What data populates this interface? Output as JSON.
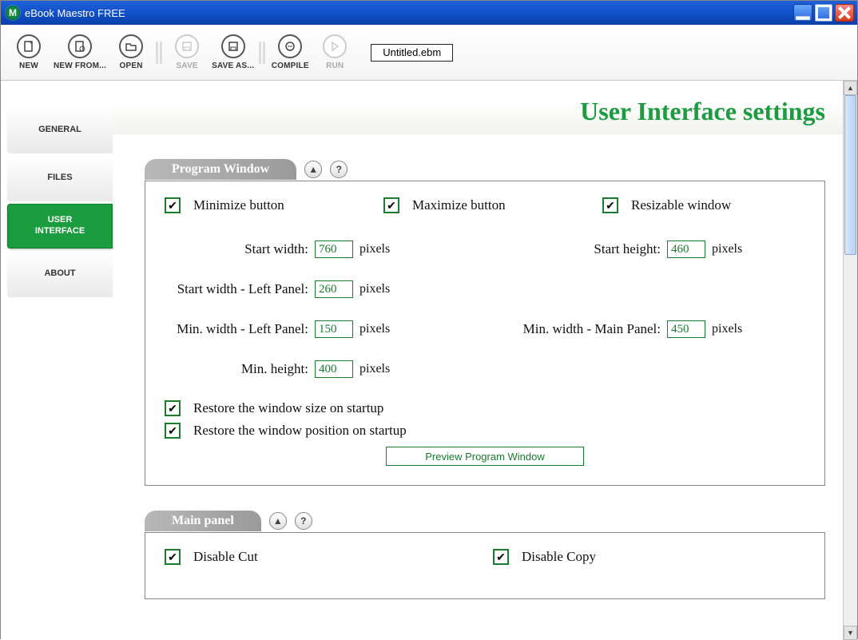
{
  "window": {
    "title": "eBook Maestro FREE",
    "file": "Untitled.ebm"
  },
  "toolbar": {
    "new": "NEW",
    "new_from": "NEW FROM...",
    "open": "OPEN",
    "save": "SAVE",
    "save_as": "SAVE AS...",
    "compile": "COMPILE",
    "run": "RUN"
  },
  "sidebar": {
    "general": "GENERAL",
    "files": "FILES",
    "ui": "USER\nINTERFACE",
    "about": "ABOUT"
  },
  "page": {
    "title": "User Interface settings"
  },
  "program_window": {
    "heading": "Program Window",
    "minimize_label": "Minimize button",
    "maximize_label": "Maximize button",
    "resizable_label": "Resizable window",
    "start_width_label": "Start width:",
    "start_width_value": "760",
    "start_height_label": "Start height:",
    "start_height_value": "460",
    "start_width_left_label": "Start width - Left Panel:",
    "start_width_left_value": "260",
    "min_width_left_label": "Min. width - Left Panel:",
    "min_width_left_value": "150",
    "min_width_main_label": "Min. width - Main Panel:",
    "min_width_main_value": "450",
    "min_height_label": "Min. height:",
    "min_height_value": "400",
    "pixels": "pixels",
    "restore_size_label": "Restore the window size on startup",
    "restore_pos_label": "Restore the window position on startup",
    "preview_btn": "Preview Program Window"
  },
  "main_panel": {
    "heading": "Main panel",
    "disable_cut_label": "Disable Cut",
    "disable_copy_label": "Disable Copy"
  },
  "icons": {
    "collapse": "▲",
    "help": "?",
    "check": "✔",
    "app_m": "M"
  }
}
